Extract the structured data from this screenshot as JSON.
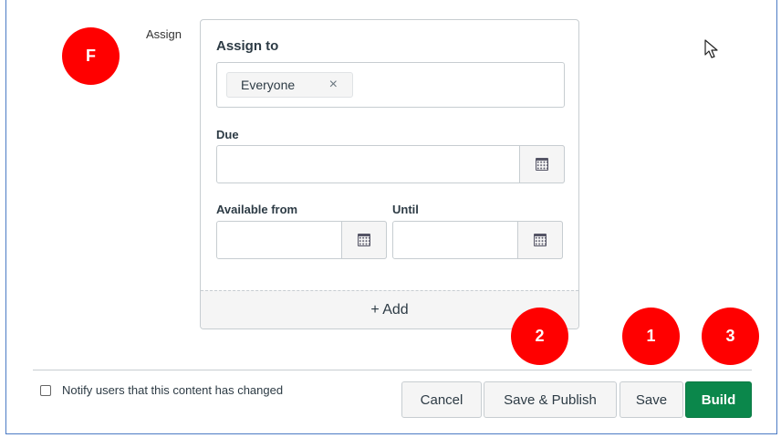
{
  "assign_section": {
    "row_label": "Assign",
    "card_title": "Assign to",
    "assignee_chip": "Everyone",
    "remove_symbol": "×",
    "due_label": "Due",
    "due_value": "",
    "available_from_label": "Available from",
    "available_from_value": "",
    "until_label": "Until",
    "until_value": "",
    "add_label": "+ Add"
  },
  "footer": {
    "notify_label": "Notify users that this content has changed",
    "notify_checked": false,
    "cancel_label": "Cancel",
    "save_publish_label": "Save & Publish",
    "save_label": "Save",
    "build_label": "Build"
  },
  "annotations": {
    "f": "F",
    "two": "2",
    "one": "1",
    "three": "3"
  },
  "colors": {
    "primary_button": "#0b874b",
    "annotation_badge": "#ff0000",
    "frame_border": "#4b7bc4"
  },
  "icons": {
    "calendar": "calendar-icon",
    "remove": "close-icon",
    "cursor": "mouse-pointer-icon"
  }
}
